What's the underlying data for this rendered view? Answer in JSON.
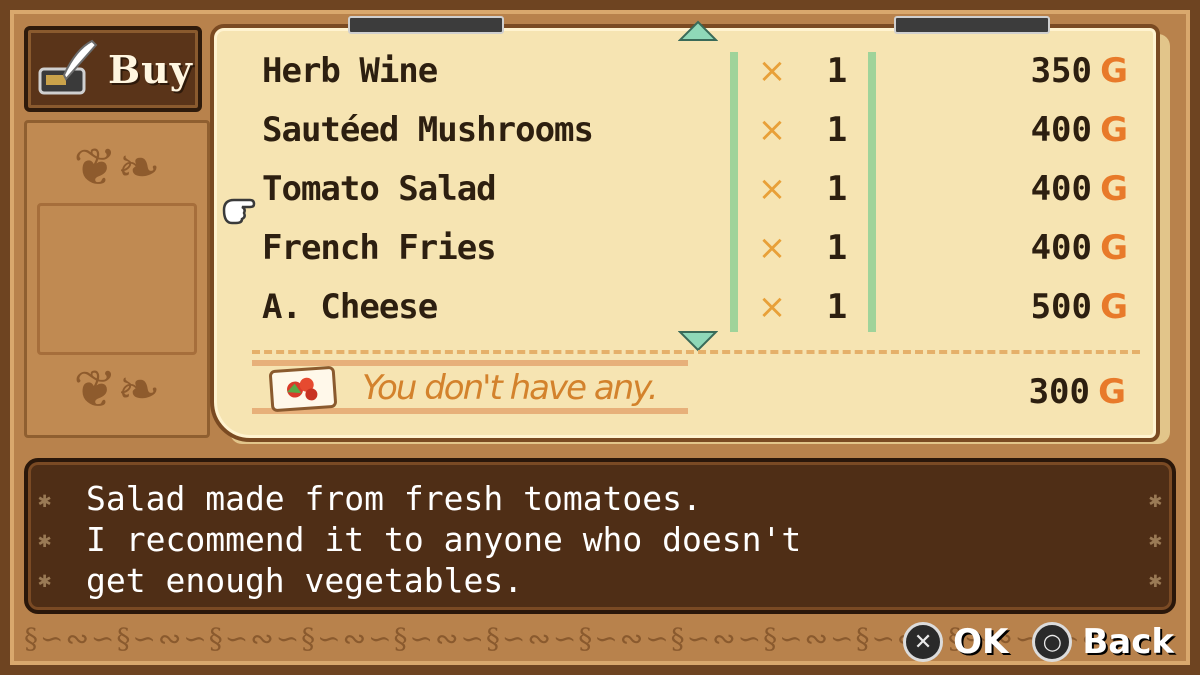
{
  "header": {
    "tab_label": "Buy"
  },
  "items": [
    {
      "name": "Herb Wine",
      "mult": "×",
      "qty": "1",
      "price": "350",
      "currency": "G"
    },
    {
      "name": "Sautéed Mushrooms",
      "mult": "×",
      "qty": "1",
      "price": "400",
      "currency": "G"
    },
    {
      "name": "Tomato Salad",
      "mult": "×",
      "qty": "1",
      "price": "400",
      "currency": "G"
    },
    {
      "name": "French Fries",
      "mult": "×",
      "qty": "1",
      "price": "400",
      "currency": "G"
    },
    {
      "name": "A.  Cheese",
      "mult": "×",
      "qty": "1",
      "price": "500",
      "currency": "G"
    }
  ],
  "selected_index": 2,
  "stock": {
    "message": "You don't have any.",
    "price": "300",
    "currency": "G"
  },
  "description": {
    "line1": "Salad made from fresh tomatoes.",
    "line2": "I recommend it to anyone who doesn't",
    "line3": "get enough vegetables."
  },
  "controls": {
    "ok_label": "OK",
    "back_label": "Back",
    "ok_icon": "cross-button-icon",
    "back_icon": "circle-button-icon"
  },
  "colors": {
    "paper": "#f6e4b2",
    "wood": "#b8824c",
    "gold_g": "#e87a2a",
    "cross": "#e8a038",
    "divider": "#9fd39a"
  }
}
